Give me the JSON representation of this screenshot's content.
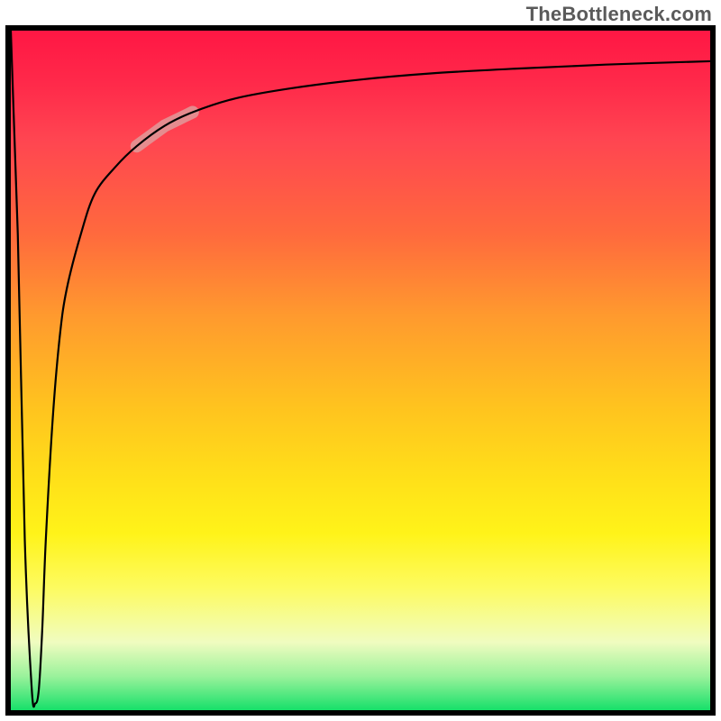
{
  "attribution": "TheBottleneck.com",
  "colors": {
    "gradient_top": "#ff1744",
    "gradient_mid": "#ffe019",
    "gradient_bottom": "#17e06a",
    "curve": "#000000",
    "highlight": "#e09a9a",
    "border": "#000000"
  },
  "chart_data": {
    "type": "line",
    "title": "",
    "xlabel": "",
    "ylabel": "",
    "xlim": [
      0,
      100
    ],
    "ylim": [
      0,
      100
    ],
    "grid": false,
    "legend": false,
    "x": [
      0,
      1,
      2,
      3,
      3.5,
      4,
      4.5,
      5,
      6,
      7,
      8,
      10,
      12,
      15,
      18,
      22,
      26,
      32,
      40,
      50,
      60,
      72,
      85,
      100
    ],
    "y": [
      100,
      70,
      25,
      3,
      1,
      3,
      12,
      25,
      43,
      55,
      62,
      70,
      76,
      80,
      83,
      86,
      88,
      90,
      91.5,
      92.8,
      93.7,
      94.4,
      95.0,
      95.5
    ],
    "highlight_segment": {
      "x_start": 18,
      "x_end": 26,
      "description": "semi-transparent thick pink stroke over portion of ascending curve"
    },
    "background": "vertical heatmap gradient from red (top, high bottleneck) through yellow to green (bottom, no bottleneck)",
    "notes": "curve starts at top-left (100), plunges down to near 1 around x≈3.5, then asymptotically rises toward ~95 at right edge"
  }
}
